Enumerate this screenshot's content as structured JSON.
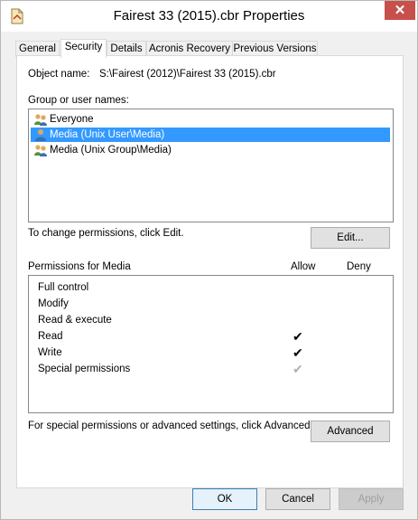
{
  "window": {
    "title": "Fairest 33 (2015).cbr Properties",
    "close_glyph": "✕"
  },
  "tabs": [
    {
      "label": "General",
      "active": false
    },
    {
      "label": "Security",
      "active": true
    },
    {
      "label": "Details",
      "active": false
    },
    {
      "label": "Acronis Recovery",
      "active": false
    },
    {
      "label": "Previous Versions",
      "active": false
    }
  ],
  "object": {
    "label": "Object name:",
    "value": "S:\\Fairest (2012)\\Fairest 33 (2015).cbr"
  },
  "groups": {
    "label": "Group or user names:",
    "items": [
      {
        "name": "Everyone",
        "icon": "users-group-icon",
        "selected": false
      },
      {
        "name": "Media (Unix User\\Media)",
        "icon": "user-icon",
        "selected": true
      },
      {
        "name": "Media (Unix Group\\Media)",
        "icon": "users-group-icon",
        "selected": false
      }
    ]
  },
  "change_hint": "To change permissions, click Edit.",
  "edit_button": "Edit...",
  "permissions": {
    "title": "Permissions for Media",
    "allow_header": "Allow",
    "deny_header": "Deny",
    "rows": [
      {
        "name": "Full control",
        "allow": false,
        "allow_inherited": false,
        "deny": false
      },
      {
        "name": "Modify",
        "allow": false,
        "allow_inherited": false,
        "deny": false
      },
      {
        "name": "Read & execute",
        "allow": false,
        "allow_inherited": false,
        "deny": false
      },
      {
        "name": "Read",
        "allow": true,
        "allow_inherited": false,
        "deny": false
      },
      {
        "name": "Write",
        "allow": true,
        "allow_inherited": false,
        "deny": false
      },
      {
        "name": "Special permissions",
        "allow": true,
        "allow_inherited": true,
        "deny": false
      }
    ],
    "check_glyph": "✔"
  },
  "advanced_hint": "For special permissions or advanced settings, click Advanced.",
  "advanced_button": "Advanced",
  "footer": {
    "ok": "OK",
    "cancel": "Cancel",
    "apply": "Apply"
  },
  "colors": {
    "selection": "#3399ff",
    "close": "#c7504b",
    "check_inherited": "#b0b0b0"
  }
}
